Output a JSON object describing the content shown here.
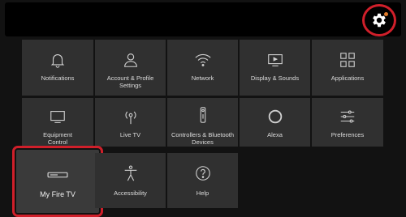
{
  "colors": {
    "highlight": "#d01f2a",
    "notification_dot": "#e07a2a",
    "tile": "#303030"
  },
  "settings_button": {
    "icon": "gear-icon"
  },
  "tiles": {
    "notifications": {
      "label": "Notifications",
      "icon": "bell-icon"
    },
    "account": {
      "label": "Account & Profile Settings",
      "icon": "person-icon"
    },
    "network": {
      "label": "Network",
      "icon": "wifi-icon"
    },
    "display": {
      "label": "Display & Sounds",
      "icon": "display-icon"
    },
    "applications": {
      "label": "Applications",
      "icon": "apps-grid-icon"
    },
    "equipment": {
      "label": "Equipment Control",
      "icon": "monitor-icon"
    },
    "live_tv": {
      "label": "Live TV",
      "icon": "antenna-icon"
    },
    "controllers": {
      "label": "Controllers & Bluetooth Devices",
      "icon": "remote-icon"
    },
    "alexa": {
      "label": "Alexa",
      "icon": "alexa-ring-icon"
    },
    "preferences": {
      "label": "Preferences",
      "icon": "sliders-icon"
    },
    "my_fire_tv": {
      "label": "My Fire TV",
      "icon": "fire-tv-stick-icon"
    },
    "accessibility": {
      "label": "Accessibility",
      "icon": "accessibility-icon"
    },
    "help": {
      "label": "Help",
      "icon": "help-icon"
    }
  }
}
